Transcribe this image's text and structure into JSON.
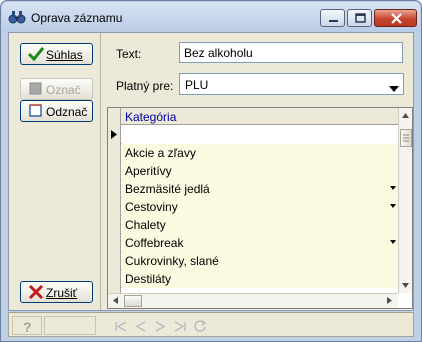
{
  "window": {
    "title": "Oprava záznamu",
    "icons": {
      "app": "binoculars-icon",
      "minimize": "minimize-icon",
      "maximize": "maximize-icon",
      "close": "close-icon"
    }
  },
  "buttons": {
    "agree": {
      "label": "Súhlas",
      "icon": "checkmark-icon"
    },
    "mark": {
      "label": "Označ",
      "icon": "mark-icon"
    },
    "unmark": {
      "label": "Odznač",
      "icon": "unmark-icon"
    },
    "cancel": {
      "label": "Zrušiť",
      "icon": "red-x-icon"
    }
  },
  "form": {
    "text_label": "Text:",
    "text_value": "Bez alkoholu",
    "valid_label": "Platný pre:",
    "valid_value": "PLU"
  },
  "grid": {
    "column": "Kategória",
    "rows": [
      {
        "text": "",
        "current": true,
        "dropdown": false
      },
      {
        "text": "Akcie a zľavy",
        "current": false,
        "dropdown": false
      },
      {
        "text": "Aperitívy",
        "current": false,
        "dropdown": false
      },
      {
        "text": "Bezmäsité jedlá",
        "current": false,
        "dropdown": true
      },
      {
        "text": "Cestoviny",
        "current": false,
        "dropdown": true
      },
      {
        "text": "Chalety",
        "current": false,
        "dropdown": false
      },
      {
        "text": "Coffebreak",
        "current": false,
        "dropdown": true
      },
      {
        "text": "Cukrovinky, slané",
        "current": false,
        "dropdown": false
      },
      {
        "text": "Destiláty",
        "current": false,
        "dropdown": false
      }
    ]
  },
  "statusbar": {
    "help_icon": "help-icon",
    "nav_icons": [
      "first-record-icon",
      "prev-record-icon",
      "next-record-icon",
      "last-record-icon",
      "refresh-icon"
    ]
  }
}
